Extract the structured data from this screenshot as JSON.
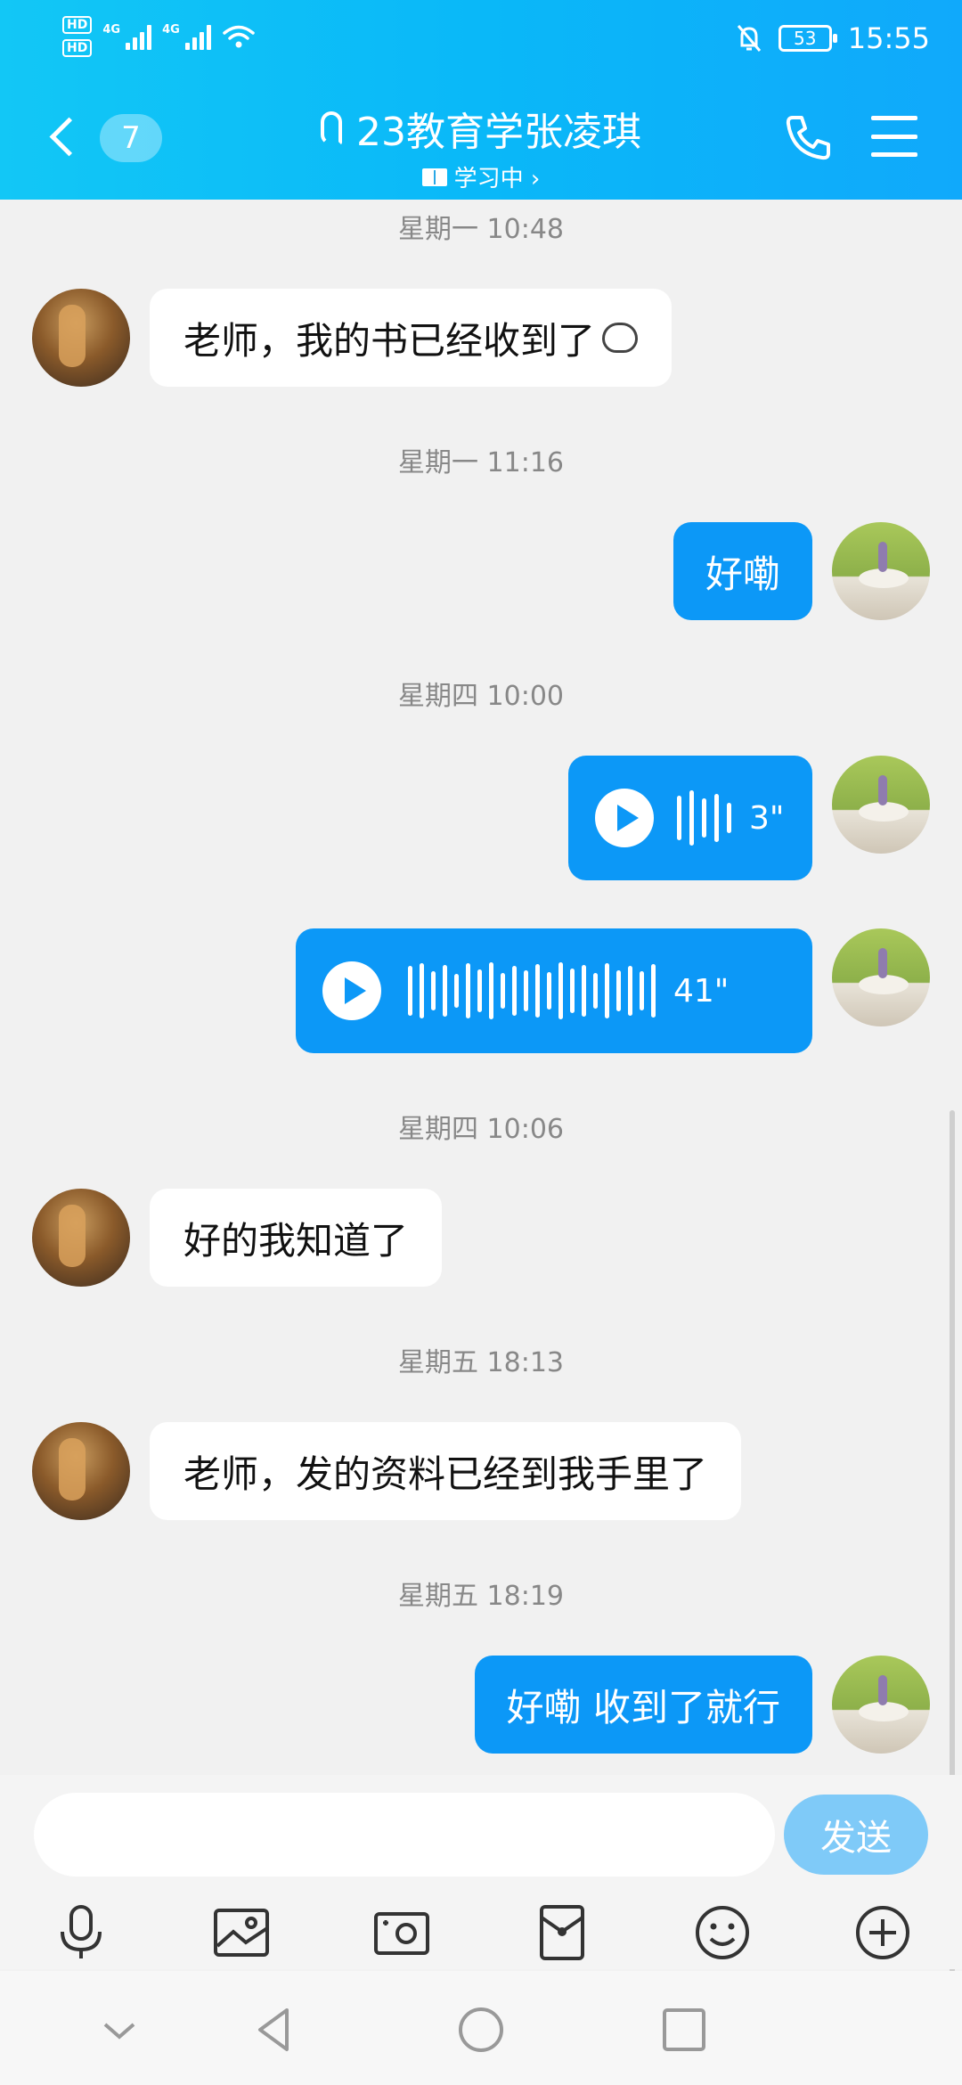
{
  "status_bar": {
    "hd1": "HD",
    "hd2": "HD",
    "sim1": "4G",
    "sim2": "4G",
    "battery": "53",
    "time": "15:55"
  },
  "header": {
    "unread_count": "7",
    "title": "23教育学张凌琪",
    "status": "学习中 ›"
  },
  "messages": [
    {
      "kind": "timestamp",
      "text": "星期一 10:48"
    },
    {
      "kind": "text",
      "from": "them",
      "text": "老师，我的书已经收到了"
    },
    {
      "kind": "timestamp",
      "text": "星期一 11:16"
    },
    {
      "kind": "text",
      "from": "me",
      "text": "好嘞"
    },
    {
      "kind": "timestamp",
      "text": "星期四 10:00"
    },
    {
      "kind": "voice",
      "from": "me",
      "duration": "3\""
    },
    {
      "kind": "voice",
      "from": "me",
      "duration": "41\""
    },
    {
      "kind": "timestamp",
      "text": "星期四 10:06"
    },
    {
      "kind": "text",
      "from": "them",
      "text": "好的我知道了"
    },
    {
      "kind": "timestamp",
      "text": "星期五 18:13"
    },
    {
      "kind": "text",
      "from": "them",
      "text": "老师，发的资料已经到我手里了"
    },
    {
      "kind": "timestamp",
      "text": "星期五 18:19"
    },
    {
      "kind": "text",
      "from": "me",
      "text": "好嘞 收到了就行"
    }
  ],
  "composer": {
    "input_value": "",
    "send_label": "发送"
  },
  "colors": {
    "header_start": "#12c7f6",
    "header_end": "#10a9fb",
    "outgoing_bubble": "#0c98f7",
    "send_button": "#7fcaf8"
  },
  "icons": {
    "toolbar": [
      "microphone-icon",
      "image-icon",
      "camera-icon",
      "red-packet-icon",
      "emoji-icon",
      "plus-icon"
    ],
    "nav": [
      "chevron-down-icon",
      "back-triangle-icon",
      "home-circle-icon",
      "recents-square-icon"
    ]
  }
}
